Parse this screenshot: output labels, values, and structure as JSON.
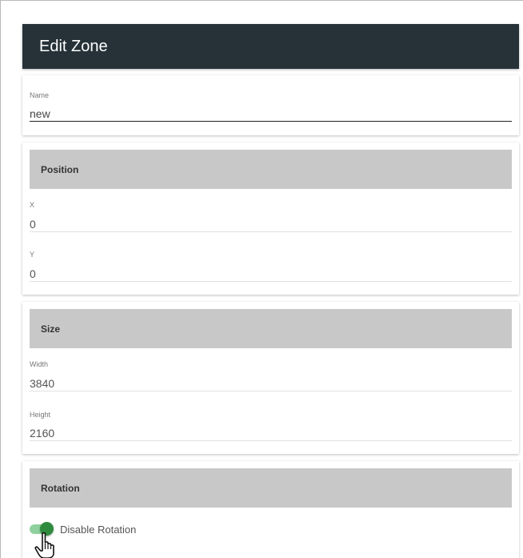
{
  "header": {
    "title": "Edit Zone"
  },
  "name_field": {
    "label": "Name",
    "value": "new"
  },
  "position": {
    "title": "Position",
    "x_label": "X",
    "x_value": "0",
    "y_label": "Y",
    "y_value": "0"
  },
  "size": {
    "title": "Size",
    "width_label": "Width",
    "width_value": "3840",
    "height_label": "Height",
    "height_value": "2160"
  },
  "rotation": {
    "title": "Rotation",
    "toggle_label": "Disable Rotation",
    "toggle_on": true
  },
  "colors": {
    "header_bg": "#263238",
    "section_bg": "#c8c8c8",
    "toggle_on": "#2e8b3e"
  },
  "icons": {
    "cursor": "hand-pointer-icon"
  }
}
